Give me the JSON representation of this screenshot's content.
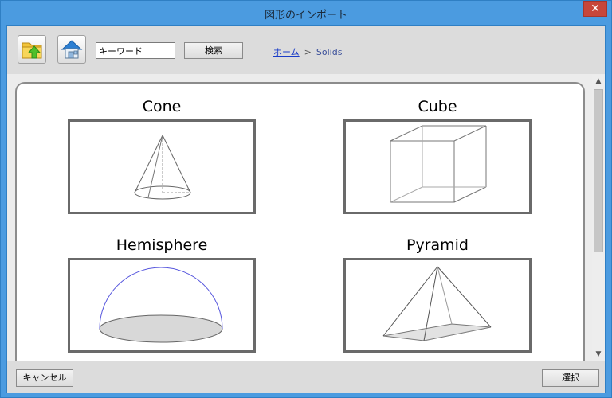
{
  "window": {
    "title": "図形のインポート",
    "close_glyph": "✕"
  },
  "toolbar": {
    "keyword_value": "キーワード",
    "search_label": "検索"
  },
  "breadcrumb": {
    "home": "ホーム",
    "separator": ">",
    "current": "Solids"
  },
  "shapes": [
    {
      "title": "Cone"
    },
    {
      "title": "Cube"
    },
    {
      "title": "Hemisphere"
    },
    {
      "title": "Pyramid"
    }
  ],
  "footer": {
    "cancel_label": "キャンセル",
    "select_label": "選択"
  },
  "icons": {
    "upload": "folder-upload-icon",
    "home": "home-icon"
  },
  "colors": {
    "window_frame": "#4b9be0",
    "close_button": "#c7463a",
    "link": "#1a3cc7",
    "hemisphere_arc": "#5555dd",
    "client_bg": "#dcdcdc"
  }
}
